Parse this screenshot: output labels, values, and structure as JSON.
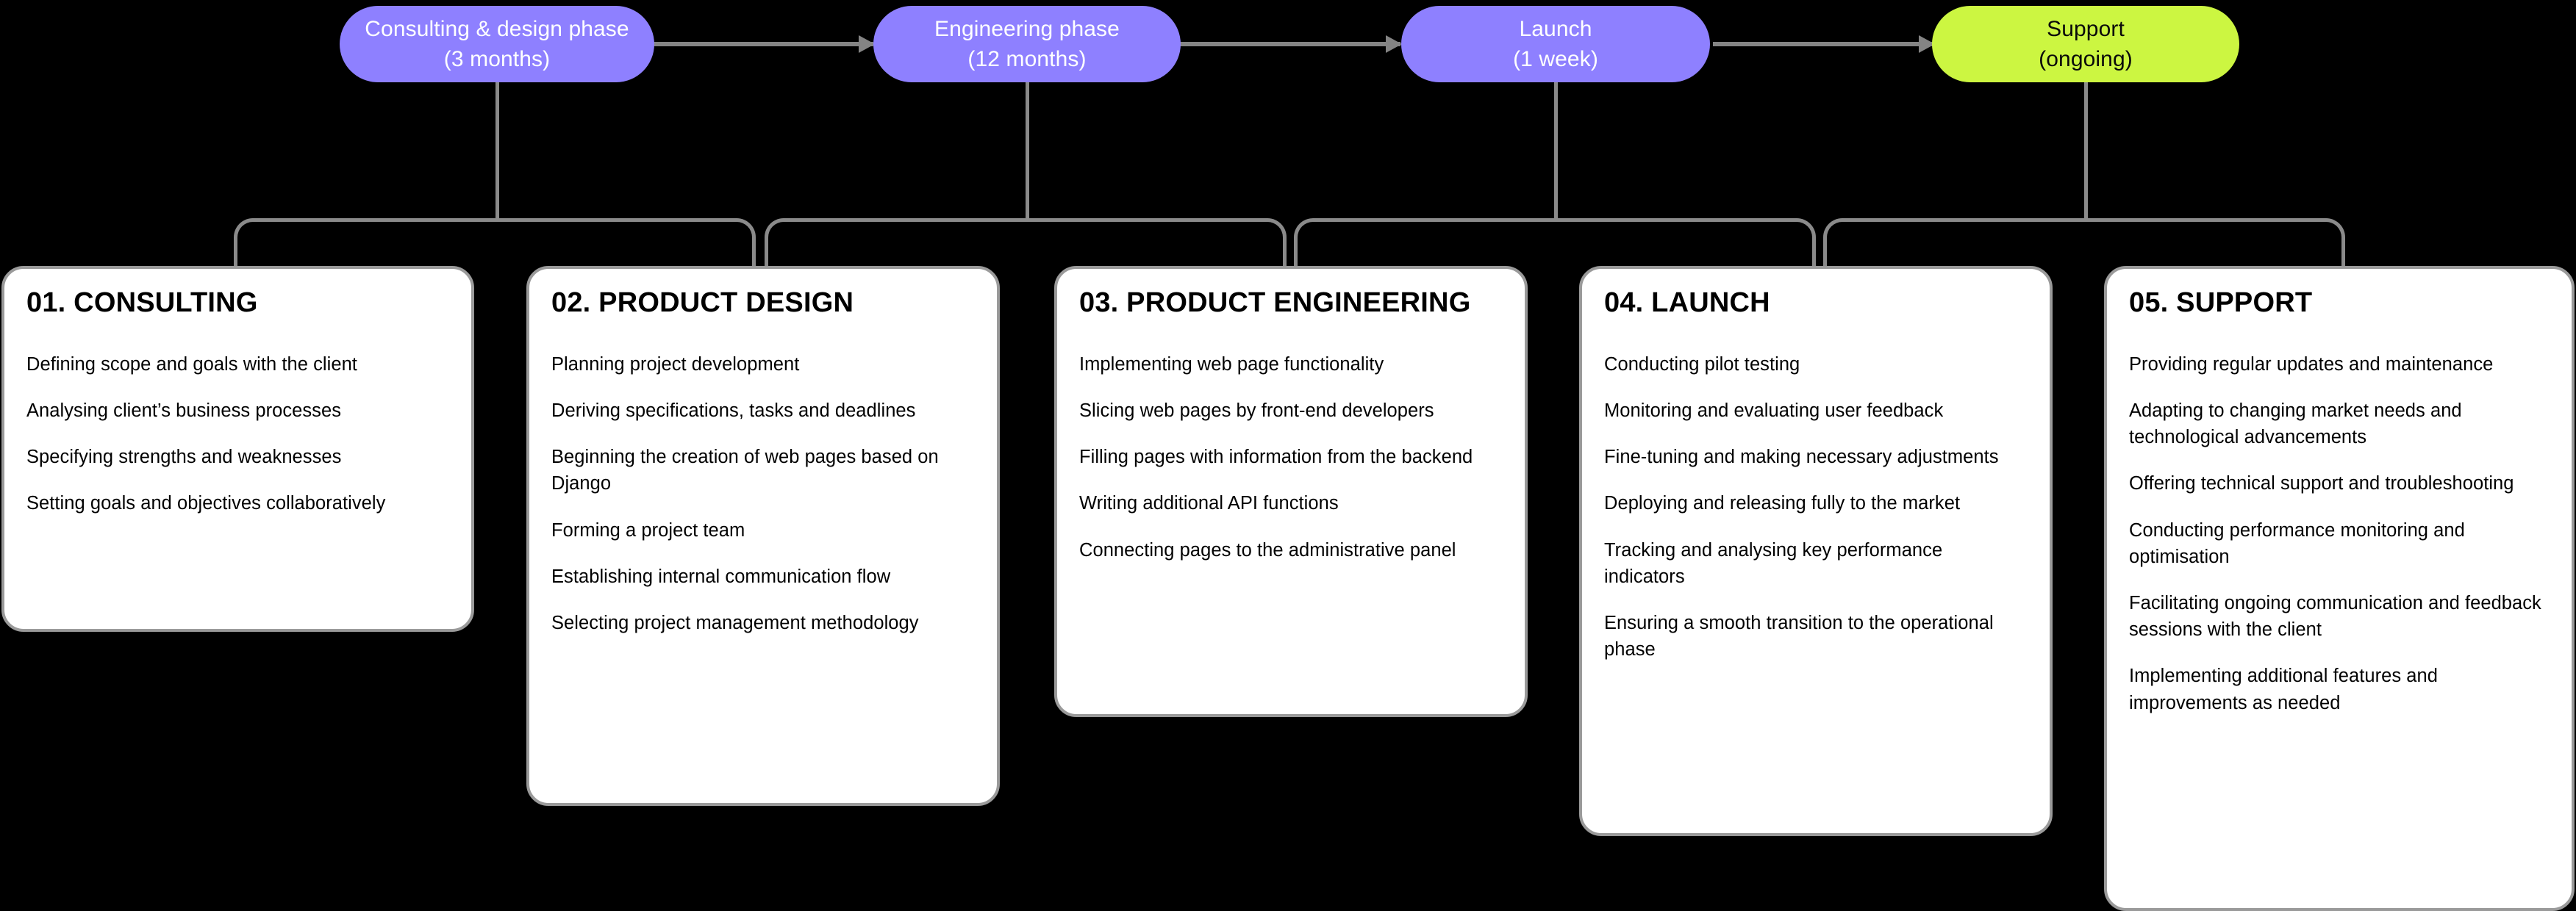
{
  "colors": {
    "background": "#000000",
    "phase_purple": "#8E80FF",
    "phase_lime": "#CCF641",
    "connector_gray": "#8A8A8A",
    "card_background": "#FFFFFF",
    "card_border": "#9A9A9A",
    "text_on_purple": "#FFFFFF",
    "text_on_lime": "#0A0A0A",
    "card_text": "#000000"
  },
  "timeline": {
    "phases": [
      {
        "name": "Consulting & design phase",
        "duration": "(3 months)",
        "color": "purple"
      },
      {
        "name": "Engineering phase",
        "duration": "(12 months)",
        "color": "purple"
      },
      {
        "name": "Launch",
        "duration": "(1 week)",
        "color": "purple"
      },
      {
        "name": "Support",
        "duration": "(ongoing)",
        "color": "lime"
      }
    ]
  },
  "cards": [
    {
      "title": "01. CONSULTING",
      "items": [
        "Defining scope and goals with the client",
        "Analysing client’s business processes",
        "Specifying strengths and weaknesses",
        "Setting goals and objectives collaboratively"
      ]
    },
    {
      "title": "02. PRODUCT DESIGN",
      "items": [
        "Planning project development",
        "Deriving specifications, tasks and deadlines",
        "Beginning the creation of web pages based on Django",
        "Forming a project team",
        "Establishing internal communication flow",
        "Selecting project management methodology"
      ]
    },
    {
      "title": "03. PRODUCT ENGINEERING",
      "items": [
        "Implementing web page functionality",
        "Slicing web pages by front-end developers",
        "Filling pages with information from the backend",
        "Writing additional API functions",
        "Connecting pages to the administrative panel"
      ]
    },
    {
      "title": "04. LAUNCH",
      "items": [
        "Conducting pilot testing",
        "Monitoring and evaluating user feedback",
        "Fine-tuning and making necessary adjustments",
        "Deploying and releasing fully to the market",
        "Tracking and analysing key performance indicators",
        "Ensuring a smooth transition to the operational phase"
      ]
    },
    {
      "title": "05. SUPPORT",
      "items": [
        "Providing regular updates and maintenance",
        "Adapting to changing market needs and technological advancements",
        "Offering technical support and troubleshooting",
        "Conducting performance monitoring and optimisation",
        "Facilitating ongoing communication and feedback sessions with the client",
        "Implementing additional features and improvements as needed"
      ]
    }
  ]
}
